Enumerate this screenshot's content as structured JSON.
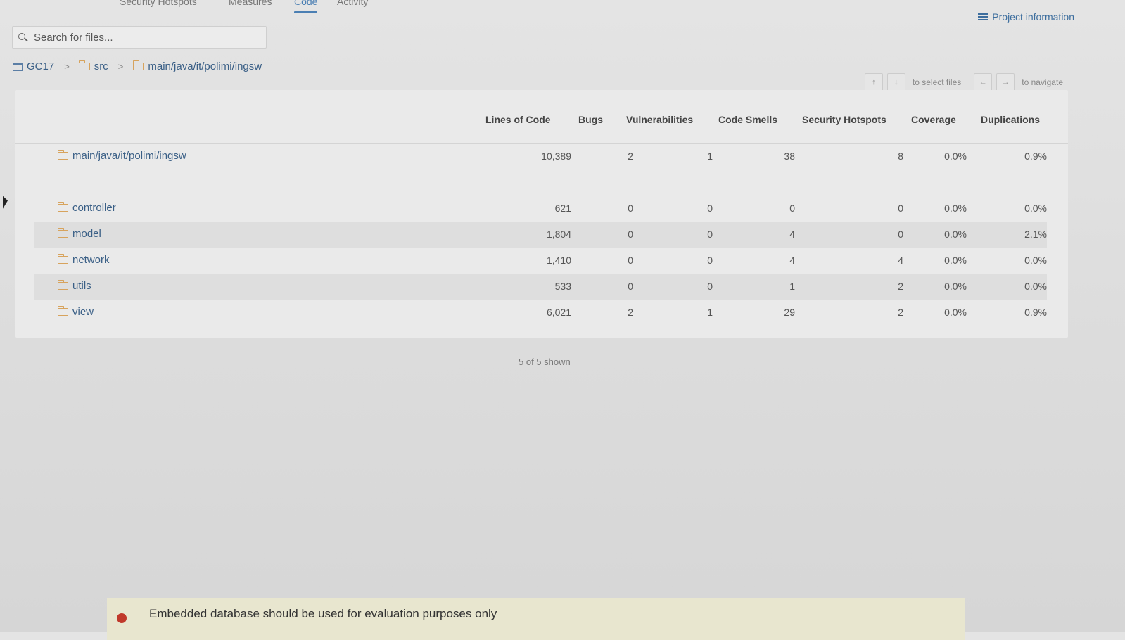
{
  "nav": {
    "tabs": [
      {
        "label": "Security Hotspots",
        "active": false
      },
      {
        "label": "Measures",
        "active": false
      },
      {
        "label": "Code",
        "active": true
      },
      {
        "label": "Activity",
        "active": false
      }
    ],
    "project_information": "Project information"
  },
  "search": {
    "placeholder": "Search for files..."
  },
  "breadcrumb": [
    {
      "label": "GC17",
      "icon": "project-icon"
    },
    {
      "label": "src",
      "icon": "folder-icon"
    },
    {
      "label": "main/java/it/polimi/ingsw",
      "icon": "folder-icon"
    }
  ],
  "keyboard_hints": {
    "select_keys": [
      "↑",
      "↓"
    ],
    "select_label": "to select files",
    "navigate_keys": [
      "←",
      "→"
    ],
    "navigate_label": "to navigate"
  },
  "table": {
    "columns": [
      "Lines of Code",
      "Bugs",
      "Vulnerabilities",
      "Code Smells",
      "Security Hotspots",
      "Coverage",
      "Duplications"
    ],
    "summary": {
      "name": "main/java/it/polimi/ingsw",
      "values": [
        "10,389",
        "2",
        "1",
        "38",
        "8",
        "0.0%",
        "0.9%"
      ]
    },
    "rows": [
      {
        "name": "controller",
        "values": [
          "621",
          "0",
          "0",
          "0",
          "0",
          "0.0%",
          "0.0%"
        ]
      },
      {
        "name": "model",
        "values": [
          "1,804",
          "0",
          "0",
          "4",
          "0",
          "0.0%",
          "2.1%"
        ]
      },
      {
        "name": "network",
        "values": [
          "1,410",
          "0",
          "0",
          "4",
          "4",
          "0.0%",
          "0.0%"
        ]
      },
      {
        "name": "utils",
        "values": [
          "533",
          "0",
          "0",
          "1",
          "2",
          "0.0%",
          "0.0%"
        ]
      },
      {
        "name": "view",
        "values": [
          "6,021",
          "2",
          "1",
          "29",
          "2",
          "0.0%",
          "0.9%"
        ]
      }
    ],
    "shown": "5 of 5 shown"
  },
  "footer": {
    "message": "Embedded database should be used for evaluation purposes only"
  },
  "colors": {
    "link": "#3a5f86",
    "accent": "#4b7fb3",
    "folder": "#d7a35d"
  }
}
